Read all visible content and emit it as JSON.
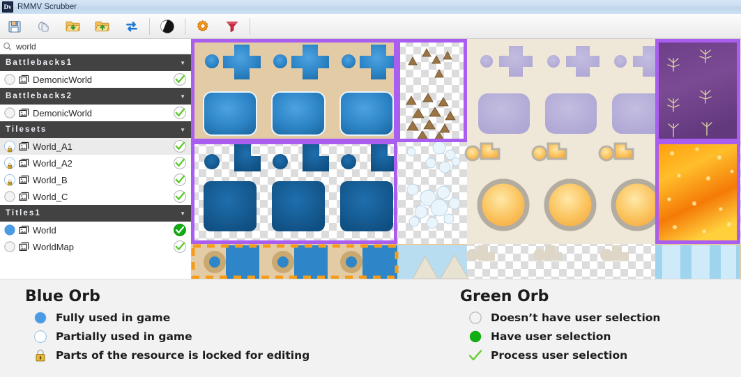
{
  "window": {
    "title": "RMMV Scrubber",
    "app_icon_label": "Dv",
    "app_icon": "app-logo-icon"
  },
  "toolbar": {
    "buttons": [
      {
        "name": "save",
        "icon": "floppy-disk-save-icon",
        "label": "Save"
      },
      {
        "name": "scrub",
        "icon": "scrub-hand-icon",
        "label": "Scrub"
      },
      {
        "name": "open-project",
        "icon": "folder-open-green-down-icon",
        "label": "Open Project"
      },
      {
        "name": "open-folder",
        "icon": "folder-open-green-up-icon",
        "label": "Open Folder"
      },
      {
        "name": "refresh",
        "icon": "refresh-arrows-icon",
        "label": "Refresh"
      },
      {
        "name": "contrast",
        "icon": "contrast-circle-icon",
        "label": "Contrast"
      },
      {
        "name": "settings",
        "icon": "gear-orange-icon",
        "label": "Settings"
      },
      {
        "name": "filter",
        "icon": "funnel-filter-icon",
        "label": "Filter"
      }
    ]
  },
  "search": {
    "icon": "search-icon",
    "value": "world",
    "placeholder": "Search"
  },
  "sidebar": {
    "groups": [
      {
        "name": "battlebacks1",
        "label": "Battlebacks1",
        "expanded": true,
        "chevron": "▼",
        "items": [
          {
            "label": "DemonicWorld",
            "blue_orb": "empty",
            "locked": false,
            "green_orb": "outline-check",
            "selected": false,
            "thumb_icon": "image-thumbnail-icon"
          }
        ]
      },
      {
        "name": "battlebacks2",
        "label": "Battlebacks2",
        "expanded": true,
        "chevron": "▼",
        "items": [
          {
            "label": "DemonicWorld",
            "blue_orb": "empty",
            "locked": false,
            "green_orb": "outline-check",
            "selected": false,
            "thumb_icon": "image-thumbnail-icon"
          }
        ]
      },
      {
        "name": "tilesets",
        "label": "Tilesets",
        "expanded": true,
        "chevron": "▼",
        "items": [
          {
            "label": "World_A1",
            "blue_orb": "partial",
            "locked": true,
            "green_orb": "outline-check",
            "selected": true,
            "thumb_icon": "image-thumbnail-icon"
          },
          {
            "label": "World_A2",
            "blue_orb": "partial",
            "locked": true,
            "green_orb": "outline-check",
            "selected": false,
            "thumb_icon": "image-thumbnail-icon"
          },
          {
            "label": "World_B",
            "blue_orb": "partial",
            "locked": true,
            "green_orb": "outline-check",
            "selected": false,
            "thumb_icon": "image-thumbnail-icon"
          },
          {
            "label": "World_C",
            "blue_orb": "empty",
            "locked": false,
            "green_orb": "outline-check",
            "selected": false,
            "thumb_icon": "image-thumbnail-icon"
          }
        ]
      },
      {
        "name": "titles1",
        "label": "Titles1",
        "expanded": true,
        "chevron": "▼",
        "items": [
          {
            "label": "World",
            "blue_orb": "full",
            "locked": false,
            "green_orb": "filled-check",
            "selected": false,
            "thumb_icon": "image-thumbnail-icon"
          },
          {
            "label": "WorldMap",
            "blue_orb": "empty",
            "locked": false,
            "green_orb": "outline-check",
            "selected": false,
            "thumb_icon": "image-thumbnail-icon"
          }
        ]
      }
    ]
  },
  "preview": {
    "name": "tileset-preview",
    "selection_border_color": "#a95ef0",
    "marquee_border_color": "#f59c1a",
    "description": "World_A1 tileset sheet preview with water, rock, ice, lava and desert tiles"
  },
  "legend": {
    "blue": {
      "title": "Blue Orb",
      "rows": [
        {
          "icon": "blue-orb-full-icon",
          "label": "Fully used in game"
        },
        {
          "icon": "blue-orb-partial-icon",
          "label": "Partially used in game"
        },
        {
          "icon": "gold-padlock-icon",
          "label": "Parts of the resource is locked for editing"
        }
      ]
    },
    "green": {
      "title": "Green Orb",
      "rows": [
        {
          "icon": "grey-orb-empty-icon",
          "label": "Doesn’t have user selection"
        },
        {
          "icon": "green-orb-filled-icon",
          "label": "Have user selection"
        },
        {
          "icon": "green-check-icon",
          "label": "Process user selection"
        }
      ]
    }
  },
  "colors": {
    "blue_orb": "#4a9ae4",
    "green_orb": "#11ad11",
    "green_check": "#5fcc2f",
    "group_header_bg": "#424242",
    "selection_purple": "#a95ef0",
    "marquee_orange": "#f59c1a"
  }
}
